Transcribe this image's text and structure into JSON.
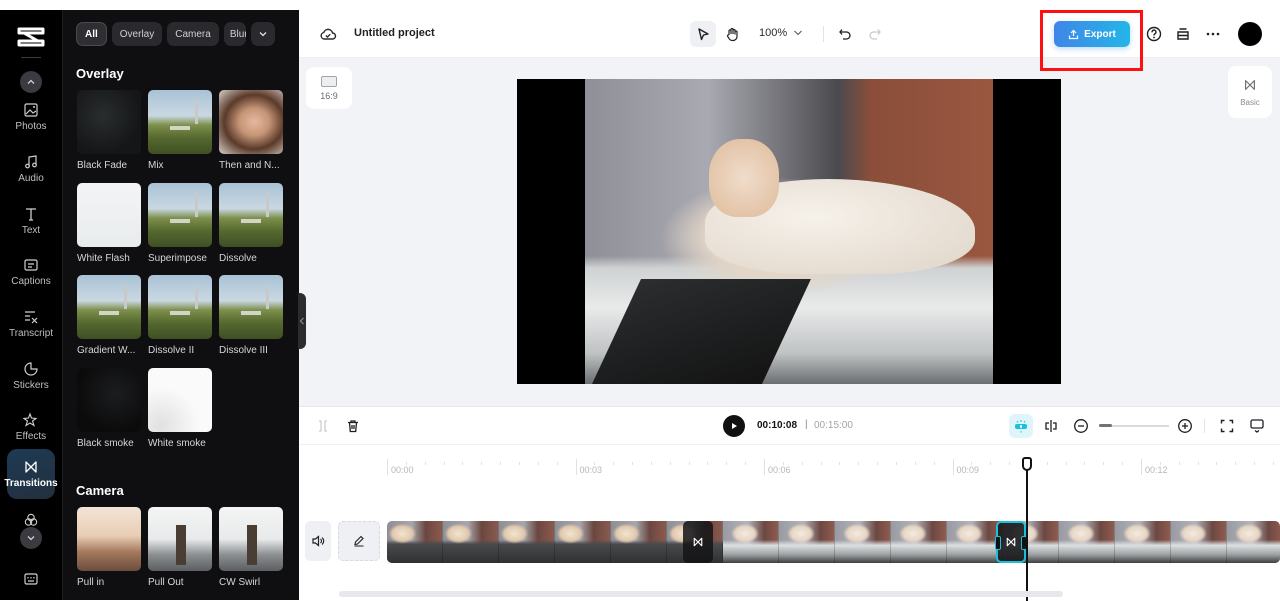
{
  "app": {
    "name": "CapCut",
    "brand_color": "#000000",
    "accent_color": "#19c1dd"
  },
  "rail": {
    "items": [
      {
        "id": "photos",
        "label": "Photos",
        "icon": "image-icon"
      },
      {
        "id": "audio",
        "label": "Audio",
        "icon": "music-icon"
      },
      {
        "id": "text",
        "label": "Text",
        "icon": "text-icon"
      },
      {
        "id": "captions",
        "label": "Captions",
        "icon": "captions-icon"
      },
      {
        "id": "transcript",
        "label": "Transcript",
        "icon": "transcript-icon"
      },
      {
        "id": "stickers",
        "label": "Stickers",
        "icon": "sticker-icon"
      },
      {
        "id": "effects",
        "label": "Effects",
        "icon": "sparkle-icon"
      },
      {
        "id": "transitions",
        "label": "Transitions",
        "icon": "transition-icon",
        "active": true
      },
      {
        "id": "filters",
        "label": "",
        "icon": "filters-icon"
      }
    ]
  },
  "panel": {
    "chips": [
      {
        "label": "All",
        "active": true
      },
      {
        "label": "Overlay"
      },
      {
        "label": "Camera"
      },
      {
        "label": "Blur"
      }
    ],
    "sections": [
      {
        "title": "Overlay",
        "items": [
          {
            "label": "Black Fade"
          },
          {
            "label": "Mix"
          },
          {
            "label": "Then and N..."
          },
          {
            "label": "White Flash"
          },
          {
            "label": "Superimpose"
          },
          {
            "label": "Dissolve"
          },
          {
            "label": "Gradient W..."
          },
          {
            "label": "Dissolve II"
          },
          {
            "label": "Dissolve III"
          },
          {
            "label": "Black smoke"
          },
          {
            "label": "White smoke"
          }
        ]
      },
      {
        "title": "Camera",
        "items": [
          {
            "label": "Pull in"
          },
          {
            "label": "Pull Out"
          },
          {
            "label": "CW Swirl"
          }
        ]
      }
    ]
  },
  "topbar": {
    "project_title": "Untitled project",
    "zoom_level": "100%",
    "export_label": "Export",
    "export_colors": [
      "#3f86e8",
      "#24b6e8"
    ]
  },
  "canvas": {
    "aspect_ratio": "16:9",
    "right_panel_label": "Basic"
  },
  "timeline": {
    "current_time": "00:10:08",
    "separator": "|",
    "total_time": "00:15:00",
    "zoom_slider_fraction": 0.18,
    "ruler_labels": [
      "00:00",
      "00:03",
      "00:06",
      "00:09",
      "00:12"
    ]
  }
}
